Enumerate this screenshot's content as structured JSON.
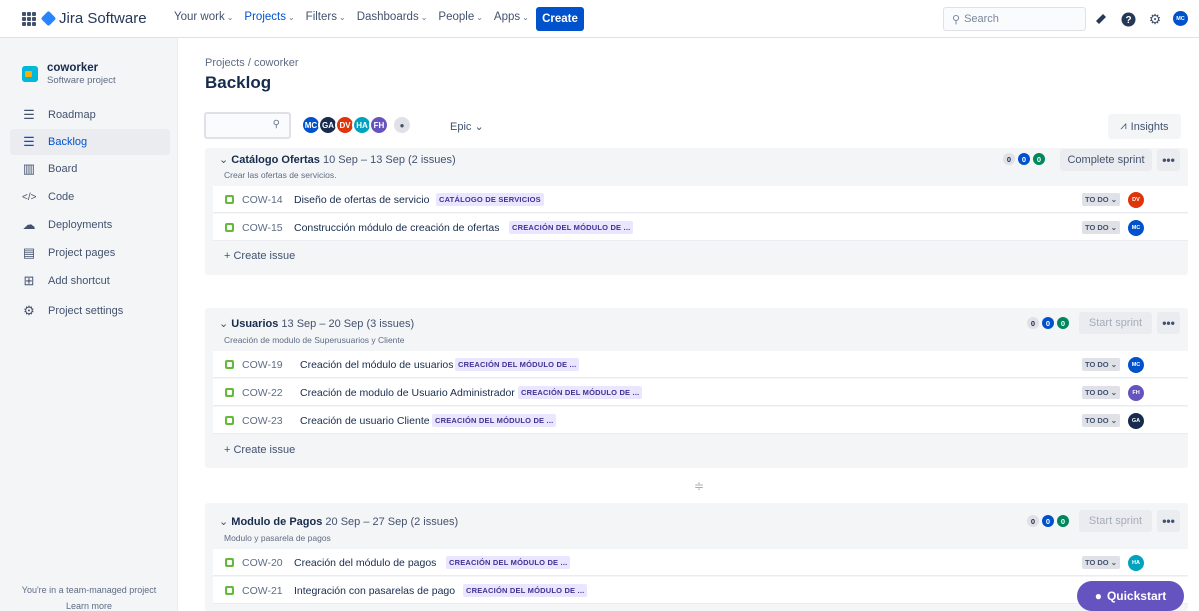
{
  "topbar": {
    "product": "Jira Software",
    "nav": [
      "Your work",
      "Projects",
      "Filters",
      "Dashboards",
      "People",
      "Apps"
    ],
    "active_nav": "Projects",
    "create": "Create",
    "search_placeholder": "Search",
    "user_initials": "MC"
  },
  "sidebar": {
    "project_name": "coworker",
    "project_type": "Software project",
    "items": [
      {
        "label": "Roadmap",
        "icon": "roadmap-icon"
      },
      {
        "label": "Backlog",
        "icon": "backlog-icon"
      },
      {
        "label": "Board",
        "icon": "board-icon"
      },
      {
        "label": "Code",
        "icon": "code-icon"
      },
      {
        "label": "Deployments",
        "icon": "deployments-icon"
      },
      {
        "label": "Project pages",
        "icon": "pages-icon"
      },
      {
        "label": "Add shortcut",
        "icon": "add-shortcut-icon"
      },
      {
        "label": "Project settings",
        "icon": "settings-icon"
      }
    ],
    "footer": "You're in a team-managed project",
    "learn_more": "Learn more"
  },
  "header": {
    "breadcrumb_projects": "Projects",
    "breadcrumb_sep": "/",
    "breadcrumb_project": "coworker",
    "title": "Backlog"
  },
  "filters": {
    "avatars": [
      {
        "i": "MC",
        "c": "#0052cc"
      },
      {
        "i": "GA",
        "c": "#172b4d"
      },
      {
        "i": "DV",
        "c": "#de350b"
      },
      {
        "i": "HA",
        "c": "#00a3bf"
      },
      {
        "i": "FH",
        "c": "#6554c0"
      }
    ],
    "epic": "Epic",
    "insights": "Insights"
  },
  "sprints": [
    {
      "name": "Catálogo Ofertas",
      "dates": "10 Sep – 13 Sep",
      "count": "(2 issues)",
      "desc": "Crear las ofertas de servicios.",
      "counts": [
        "0",
        "0",
        "0"
      ],
      "action": "Complete sprint",
      "issues": [
        {
          "key": "COW-14",
          "summary": "Diseño de ofertas de servicio",
          "label": "CATÁLOGO DE SERVICIOS",
          "status": "TO DO",
          "av": "DV",
          "avc": "#de350b"
        },
        {
          "key": "COW-15",
          "summary": "Construcción módulo de creación de ofertas",
          "label": "CREACIÓN DEL MÓDULO DE ...",
          "status": "TO DO",
          "av": "MC",
          "avc": "#0052cc"
        }
      ]
    },
    {
      "name": "Usuarios",
      "dates": "13 Sep – 20 Sep",
      "count": "(3 issues)",
      "desc": "Creación de modulo de Superusuarios y Cliente",
      "counts": [
        "0",
        "0",
        "0"
      ],
      "action": "Start sprint",
      "issues": [
        {
          "key": "COW-19",
          "summary": "Creación del módulo de usuarios",
          "label": "CREACIÓN DEL MÓDULO DE ...",
          "status": "TO DO",
          "av": "MC",
          "avc": "#0052cc"
        },
        {
          "key": "COW-22",
          "summary": "Creación de modulo de Usuario Administrador",
          "label": "CREACIÓN DEL MÓDULO DE ...",
          "status": "TO DO",
          "av": "FH",
          "avc": "#6554c0"
        },
        {
          "key": "COW-23",
          "summary": "Creación de usuario Cliente",
          "label": "CREACIÓN DEL MÓDULO DE ...",
          "status": "TO DO",
          "av": "GA",
          "avc": "#172b4d"
        }
      ]
    },
    {
      "name": "Modulo de Pagos",
      "dates": "20 Sep – 27 Sep",
      "count": "(2 issues)",
      "desc": "Modulo y pasarela de pagos",
      "counts": [
        "0",
        "0",
        "0"
      ],
      "action": "Start sprint",
      "issues": [
        {
          "key": "COW-20",
          "summary": "Creación del módulo de pagos",
          "label": "CREACIÓN DEL MÓDULO DE ...",
          "status": "TO DO",
          "av": "HA",
          "avc": "#00a3bf"
        },
        {
          "key": "COW-21",
          "summary": "Integración con pasarelas de pago",
          "label": "CREACIÓN DEL MÓDULO DE ...",
          "status": "TO DO",
          "av": "",
          "avc": "#6554c0"
        }
      ]
    }
  ],
  "create_issue": "+ Create issue",
  "quickstart": "Quickstart"
}
